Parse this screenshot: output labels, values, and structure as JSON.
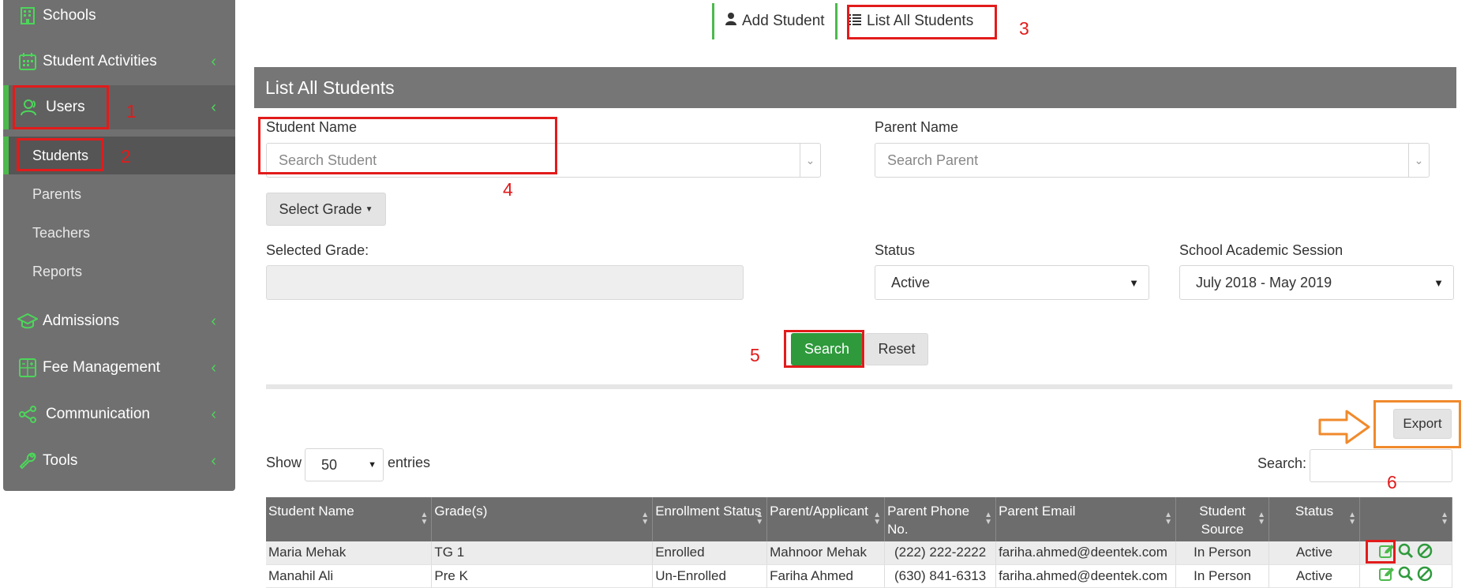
{
  "sidebar": {
    "items": [
      {
        "label": "Schools",
        "icon": "building-icon"
      },
      {
        "label": "Student Activities",
        "icon": "calendar-icon"
      },
      {
        "label": "Users",
        "icon": "users-icon"
      },
      {
        "label": "Admissions",
        "icon": "graduation-cap-icon"
      },
      {
        "label": "Fee Management",
        "icon": "calculator-icon"
      },
      {
        "label": "Communication",
        "icon": "share-icon"
      },
      {
        "label": "Tools",
        "icon": "wrench-icon"
      }
    ],
    "subitems": [
      "Students",
      "Parents",
      "Teachers",
      "Reports"
    ],
    "chevron": "‹"
  },
  "tabs": {
    "add_student": "Add Student",
    "list_all_students": "List All Students"
  },
  "panel": {
    "title": "List All Students"
  },
  "filters": {
    "student_name_label": "Student Name",
    "student_name_placeholder": "Search Student",
    "parent_name_label": "Parent Name",
    "parent_name_placeholder": "Search Parent",
    "select_grade_button": "Select Grade",
    "selected_grade_label": "Selected Grade:",
    "status_label": "Status",
    "status_value": "Active",
    "session_label": "School Academic Session",
    "session_value": "July 2018 - May 2019",
    "search_button": "Search",
    "reset_button": "Reset"
  },
  "export_button": "Export",
  "table_controls": {
    "show": "Show",
    "entries_value": "50",
    "entries": "entries",
    "search_label": "Search:"
  },
  "table": {
    "headers": [
      "Student Name",
      "Grade(s)",
      "Enrollment Status",
      "Parent/Applicant",
      "Parent Phone No.",
      "Parent Email",
      "Student Source",
      "Status",
      ""
    ],
    "rows": [
      [
        "Maria Mehak",
        "TG 1",
        "Enrolled",
        "Mahnoor Mehak",
        "(222) 222-2222",
        "fariha.ahmed@deentek.com",
        "In Person",
        "Active"
      ],
      [
        "Manahil Ali",
        "Pre K",
        "Un-Enrolled",
        "Fariha Ahmed",
        "(630) 841-6313",
        "fariha.ahmed@deentek.com",
        "In Person",
        "Active"
      ]
    ]
  },
  "annotations": [
    "1",
    "2",
    "3",
    "4",
    "5",
    "6"
  ],
  "colors": {
    "sidebar": "#707070",
    "accent_green": "#4cba4c",
    "annotation_red": "#e21b1b",
    "annotation_orange": "#f08a2c",
    "search_green": "#2e9a3c"
  }
}
